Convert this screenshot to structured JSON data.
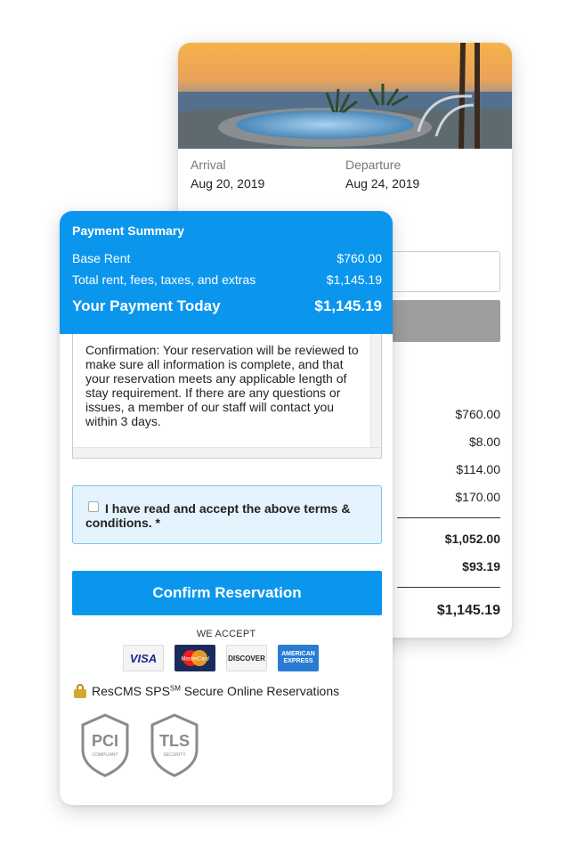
{
  "booking": {
    "arrival_label": "Arrival",
    "arrival_date": "Aug 20, 2019",
    "departure_label": "Departure",
    "departure_date": "Aug 24, 2019",
    "amounts": [
      "$760.00",
      "$8.00",
      "$114.00",
      "$170.00"
    ],
    "subtotal": "$1,052.00",
    "tax": "$93.19",
    "total": "$1,145.19"
  },
  "summary": {
    "title": "Payment Summary",
    "base_rent_label": "Base Rent",
    "base_rent_value": "$760.00",
    "total_label": "Total rent, fees, taxes, and extras",
    "total_value": "$1,145.19",
    "today_label": "Your Payment Today",
    "today_value": "$1,145.19"
  },
  "terms": {
    "text": "Confirmation: Your reservation will be reviewed to make sure all information is complete, and that your reservation meets any applicable length of stay requirement. If there are any questions or issues, a member of our staff will contact you within 3 days.",
    "accept_label": "I have read and accept the above terms & conditions. *"
  },
  "confirm_label": "Confirm Reservation",
  "payment": {
    "we_accept": "WE ACCEPT",
    "cards": {
      "visa": "VISA",
      "mastercard": "MasterCard",
      "discover": "DISCOVER",
      "amex": "AMERICAN EXPRESS"
    }
  },
  "secure": {
    "brand": "ResCMS SPS",
    "mark": "SM",
    "text": " Secure Online Reservations"
  },
  "badges": {
    "pci": "PCI",
    "pci_sub": "COMPLIANT",
    "tls": "TLS",
    "tls_sub": "SECURITY"
  },
  "colors": {
    "accent": "#0b96ee",
    "accept_bg": "#e4f3fd",
    "disabled_button": "#9e9e9e"
  }
}
